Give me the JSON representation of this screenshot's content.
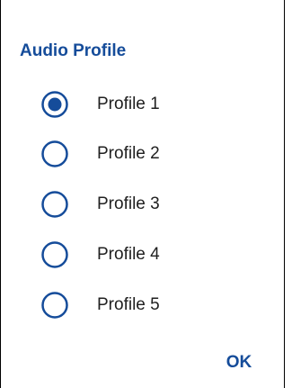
{
  "dialog": {
    "title": "Audio Profile",
    "selected_index": 0,
    "options": [
      {
        "label": "Profile 1",
        "selected": true
      },
      {
        "label": "Profile 2",
        "selected": false
      },
      {
        "label": "Profile 3",
        "selected": false
      },
      {
        "label": "Profile 4",
        "selected": false
      },
      {
        "label": "Profile 5",
        "selected": false
      }
    ],
    "ok_label": "OK"
  },
  "colors": {
    "accent": "#154c9a",
    "text": "#202020",
    "background": "#ffffff"
  }
}
